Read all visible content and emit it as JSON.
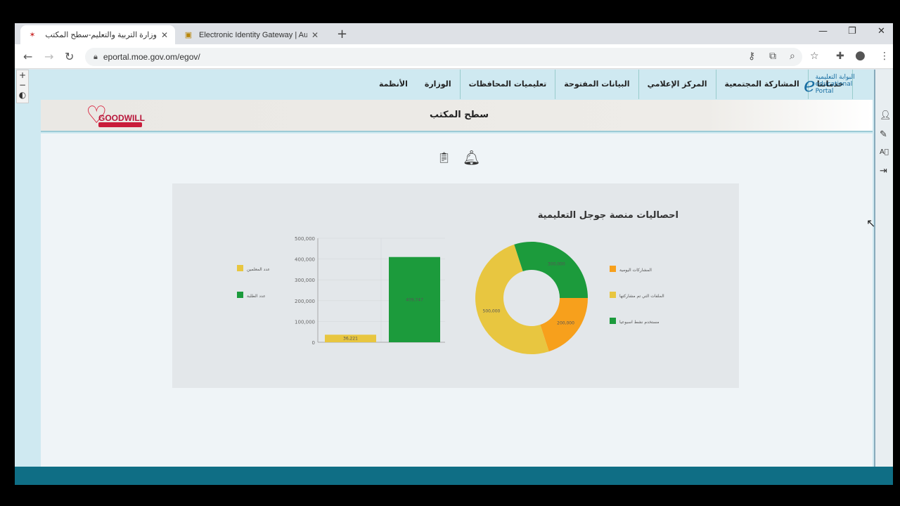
{
  "browser": {
    "tabs": [
      {
        "title": "وزارة التربية والتعليم-سطح المكتب",
        "active": true
      },
      {
        "title": "Electronic Identity Gateway | Aut",
        "active": false
      }
    ],
    "url": "eportal.moe.gov.om/egov/"
  },
  "site": {
    "logo_text": "البوابة التعليمية educational Portal",
    "nav": [
      "الأنظمة",
      "الوزارة",
      "تعليميات المحافظات",
      "البيانات المفتوحة",
      "المركز الإعلامي",
      "المشاركة المجتمعية",
      "خدماتنا"
    ],
    "goodwill_label": "GOODWILL",
    "page_title": "سطح المكتب"
  },
  "stats_panel": {
    "title": "احصاليات منصة جوجل التعليمية"
  },
  "colors": {
    "green": "#1c9b3c",
    "yellow": "#e8c640",
    "orange": "#f7a01c",
    "footer": "#0f6e85"
  },
  "chart_data": [
    {
      "type": "bar",
      "categories": [
        "عدد المعلمين",
        "عدد الطلبة"
      ],
      "values": [
        36221,
        409747
      ],
      "data_labels": [
        "36,221",
        "409,747"
      ],
      "ylim": [
        0,
        500000
      ],
      "yticks": [
        "0",
        "100,000",
        "200,000",
        "300,000",
        "400,000",
        "500,000"
      ],
      "legend": [
        "عدد المعلمين",
        "عدد الطلبة"
      ],
      "legend_placement": "left"
    },
    {
      "type": "pie",
      "labels": [
        "المشاركات اليومية",
        "الملفات التي تم مشاركتها",
        "مستخدم نشط اسبوعيا"
      ],
      "values": [
        200000,
        500000,
        300000
      ],
      "data_labels": [
        "200,000",
        "500,000",
        "300,000"
      ],
      "legend_placement": "right"
    }
  ]
}
